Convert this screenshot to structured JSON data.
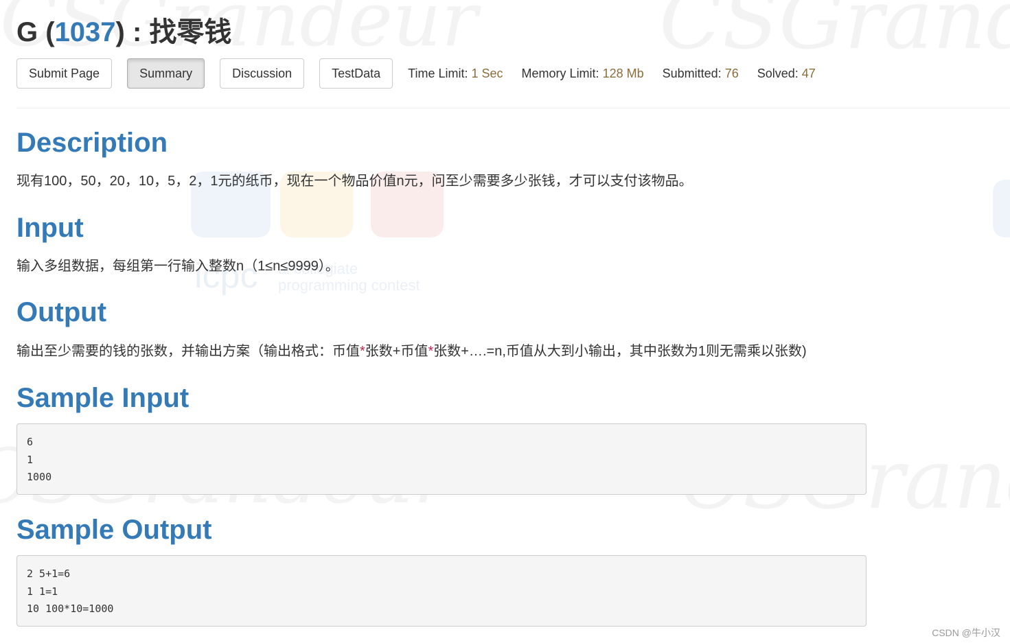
{
  "problem": {
    "letter": "G",
    "id": "1037",
    "name": "找零钱"
  },
  "toolbar": {
    "submit_label": "Submit Page",
    "summary_label": "Summary",
    "discussion_label": "Discussion",
    "testdata_label": "TestData"
  },
  "limits": {
    "time_label": "Time Limit:",
    "time_value": "1 Sec",
    "memory_label": "Memory Limit:",
    "memory_value": "128 Mb",
    "submitted_label": "Submitted:",
    "submitted_value": "76",
    "solved_label": "Solved:",
    "solved_value": "47"
  },
  "sections": {
    "description": {
      "heading": "Description",
      "text": "现有100，50，20，10，5，2，1元的纸币，现在一个物品价值n元，问至少需要多少张钱，才可以支付该物品。"
    },
    "input": {
      "heading": "Input",
      "text": "输入多组数据，每组第一行输入整数n（1≤n≤9999）。"
    },
    "output": {
      "heading": "Output",
      "text_part1": "输出至少需要的钱的张数，并输出方案（输出格式：币值",
      "star": "*",
      "text_part2": "张数+币值",
      "text_part3": "张数+….=n,币值从大到小输出，其中张数为1则无需乘以张数)"
    },
    "sample_input": {
      "heading": "Sample Input",
      "content": "6\n1\n1000"
    },
    "sample_output": {
      "heading": "Sample Output",
      "content": "2 5+1=6\n1 1=1\n10 100*10=1000"
    }
  },
  "watermark": {
    "text": "CSGrandeur",
    "icpc_text": "icpc",
    "contest_line1": "al collegiate",
    "contest_line2": "programming contest"
  },
  "footer": {
    "credit": "CSDN @牛小汉"
  }
}
